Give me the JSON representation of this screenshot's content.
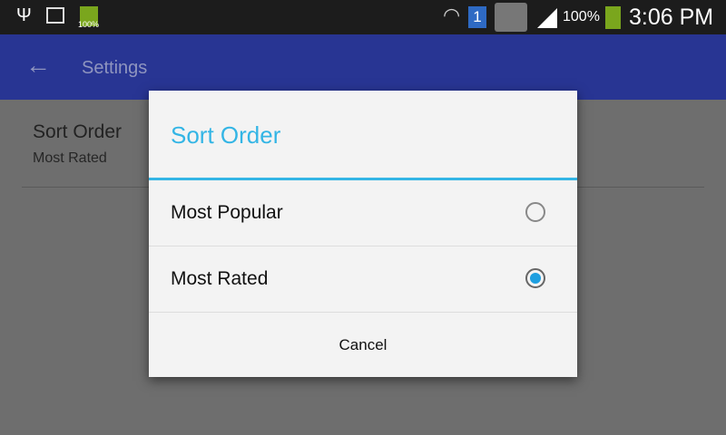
{
  "status_bar": {
    "battery_small": "100%",
    "battery": "100%",
    "time": "3:06 PM",
    "sim": "1"
  },
  "app_bar": {
    "title": "Settings"
  },
  "preference": {
    "title": "Sort Order",
    "summary": "Most Rated"
  },
  "dialog": {
    "title": "Sort Order",
    "options": [
      {
        "label": "Most Popular",
        "selected": false
      },
      {
        "label": "Most Rated",
        "selected": true
      }
    ],
    "cancel_label": "Cancel"
  },
  "colors": {
    "accent": "#33b5e5",
    "app_bar": "#3f51b5",
    "radio": "#1e9fe0"
  }
}
